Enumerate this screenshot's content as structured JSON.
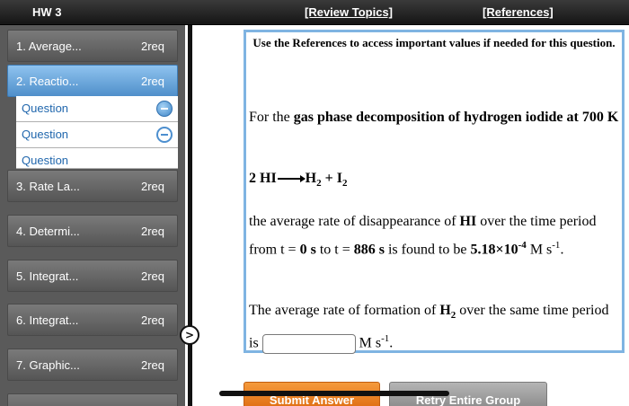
{
  "header": {
    "title": "HW 3",
    "review_topics": "[Review Topics]",
    "references": "[References]"
  },
  "sidebar": {
    "items": [
      {
        "label": "1. Average...",
        "req": "2req"
      },
      {
        "label": "2. Reactio...",
        "req": "2req",
        "active": true
      },
      {
        "label": "3. Rate La...",
        "req": "2req"
      },
      {
        "label": "4. Determi...",
        "req": "2req"
      },
      {
        "label": "5. Integrat...",
        "req": "2req"
      },
      {
        "label": "6. Integrat...",
        "req": "2req"
      },
      {
        "label": "7. Graphic...",
        "req": "2req"
      }
    ],
    "sub_items": [
      {
        "label": "Question",
        "status": "complete"
      },
      {
        "label": "Question",
        "status": "current"
      },
      {
        "label": "Question",
        "status": "none"
      }
    ]
  },
  "question": {
    "instructions": "Use the References to access important values if needed for this question.",
    "intro_pre": "For the ",
    "intro_bold": "gas phase decomposition of hydrogen iodide at 700 K",
    "equation": {
      "reactant": "2 HI",
      "product1": "H",
      "product1_sub": "2",
      "plus": " + ",
      "product2": "I",
      "product2_sub": "2"
    },
    "rate_text": {
      "part1": "the average rate of disappearance of ",
      "species": "HI",
      "part2": " over the time period from t = ",
      "t0": "0 s",
      "part3": " to t = ",
      "t1": "886 s",
      "part4": " is found to be ",
      "value": "5.18×10",
      "exponent": "-4",
      "unit_M": " M s",
      "unit_exp": "-1",
      "end": "."
    },
    "formation_text": {
      "part1": "The average rate of formation of ",
      "species": "H",
      "species_sub": "2",
      "part2": " over the same time period is",
      "unit_M": "M s",
      "unit_exp": "-1",
      "end": "."
    },
    "answer_value": ""
  },
  "buttons": {
    "submit": "Submit Answer",
    "retry": "Retry Entire Group"
  },
  "icons": {
    "collapse": "chevron-right-icon",
    "status_complete": "minus-circle-icon",
    "status_current": "minus-circle-outline-icon"
  },
  "colors": {
    "active_nav": "#5a9ad6",
    "panel_border": "#7fb4e2",
    "submit": "#ee8427",
    "retry": "#a0a0a0"
  }
}
